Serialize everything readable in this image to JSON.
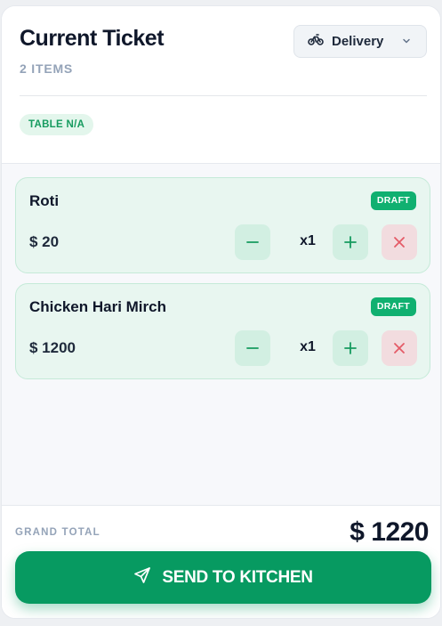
{
  "ticket": {
    "title": "Current Ticket",
    "item_count": "2 ITEMS",
    "table_badge": "TABLE N/A",
    "order_mode": {
      "label": "Delivery",
      "icon": "bicycle-icon"
    }
  },
  "items": [
    {
      "name": "Roti",
      "status": "DRAFT",
      "price": "$ 20",
      "qty": "x1"
    },
    {
      "name": "Chicken Hari Mirch",
      "status": "DRAFT",
      "price": "$ 1200",
      "qty": "x1"
    }
  ],
  "footer": {
    "grand_total_label": "GRAND TOTAL",
    "grand_total_value": "$ 1220",
    "send_button_label": "SEND TO KITCHEN"
  },
  "colors": {
    "accent": "#079a61",
    "draft_badge": "#10b070",
    "item_card_bg": "#e8f6f0",
    "remove_button_bg": "#f2dcdf",
    "remove_icon": "#e45b67"
  }
}
